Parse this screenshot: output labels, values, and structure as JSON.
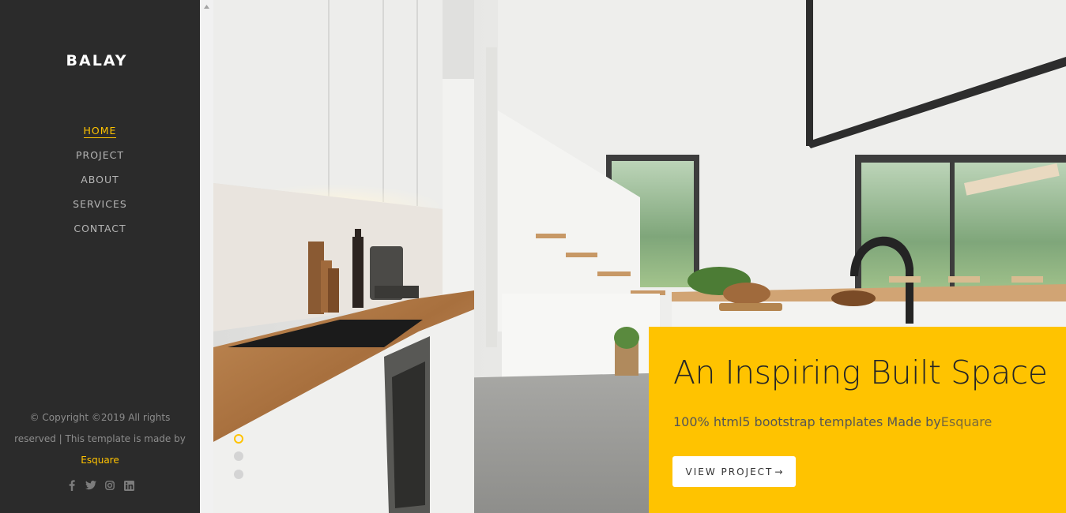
{
  "brand": "BALAY",
  "nav": [
    {
      "label": "HOME",
      "active": true
    },
    {
      "label": "PROJECT",
      "active": false
    },
    {
      "label": "ABOUT",
      "active": false
    },
    {
      "label": "SERVICES",
      "active": false
    },
    {
      "label": "CONTACT",
      "active": false
    }
  ],
  "footer": {
    "copyright": "© Copyright ©2019 All rights reserved | This template is made by",
    "credit": "Esquare",
    "socials": [
      "facebook-icon",
      "twitter-icon",
      "instagram-icon",
      "linkedin-icon"
    ]
  },
  "hero": {
    "title": "An Inspiring Built Space",
    "subtitle": "100% html5 bootstrap templates Made by",
    "subtitle_link": "Esquare",
    "button_label": "VIEW PROJECT",
    "button_arrow": "→",
    "slides": 3,
    "active_slide": 1
  },
  "colors": {
    "accent": "#ffc300",
    "sidebar_bg": "#2b2b2b",
    "nav_text": "#b5b5b5"
  }
}
